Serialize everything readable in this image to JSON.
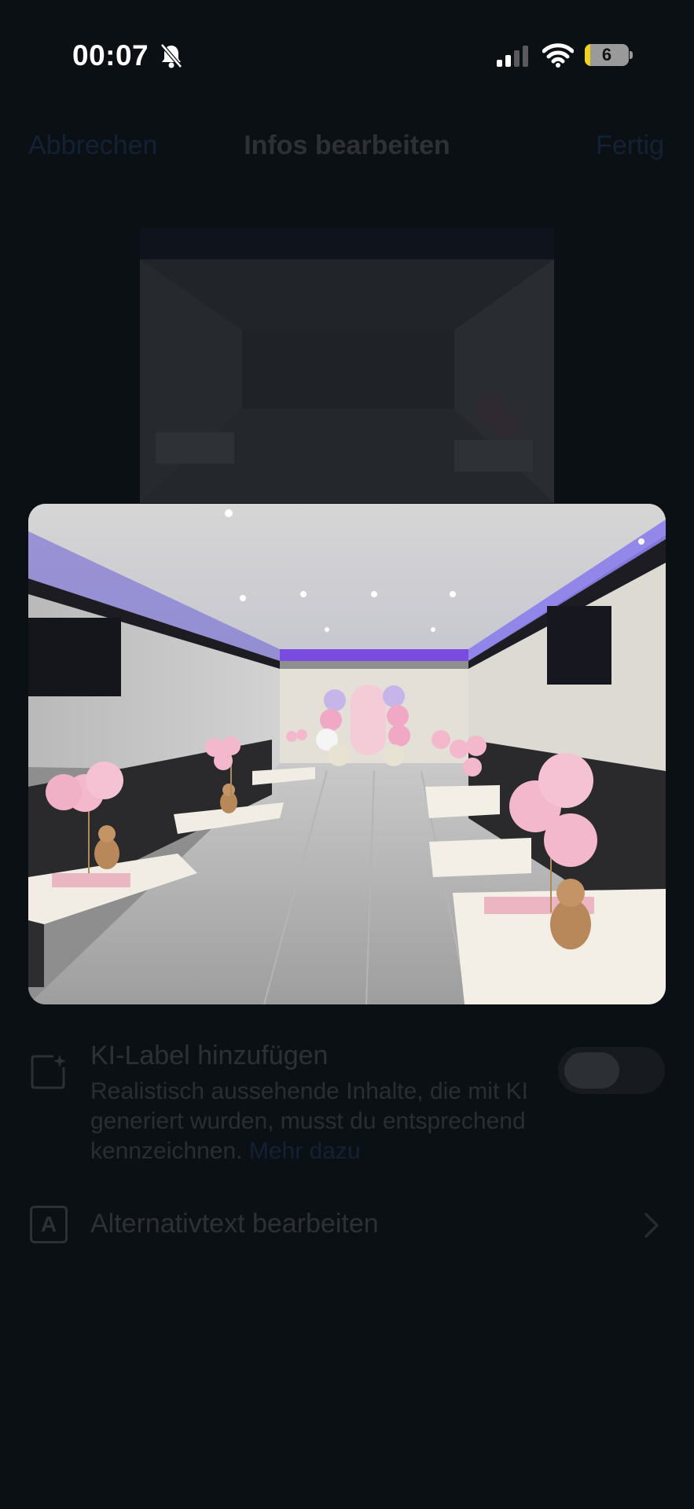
{
  "status": {
    "time": "00:07",
    "battery_level": "6",
    "battery_fraction": 0.12
  },
  "nav": {
    "cancel": "Abbrechen",
    "title": "Infos bearbeiten",
    "done": "Fertig"
  },
  "ai_label": {
    "title": "KI-Label hinzufügen",
    "description": "Realistisch aussehende Inhalte, die mit KI generiert wurden, musst du entsprechend kennzeichnen.",
    "more": "Mehr dazu",
    "enabled": false
  },
  "alt_text": {
    "icon_letter": "A",
    "label": "Alternativtext bearbeiten"
  },
  "icons": [
    "bell-muted-icon",
    "cellular-signal-icon",
    "wifi-icon",
    "battery-icon",
    "ai-sparkle-icon",
    "alt-text-icon",
    "chevron-right-icon"
  ],
  "colors": {
    "background": "#0b1015",
    "accent": "#4a7bd6",
    "battery_fill": "#f2d21b"
  }
}
